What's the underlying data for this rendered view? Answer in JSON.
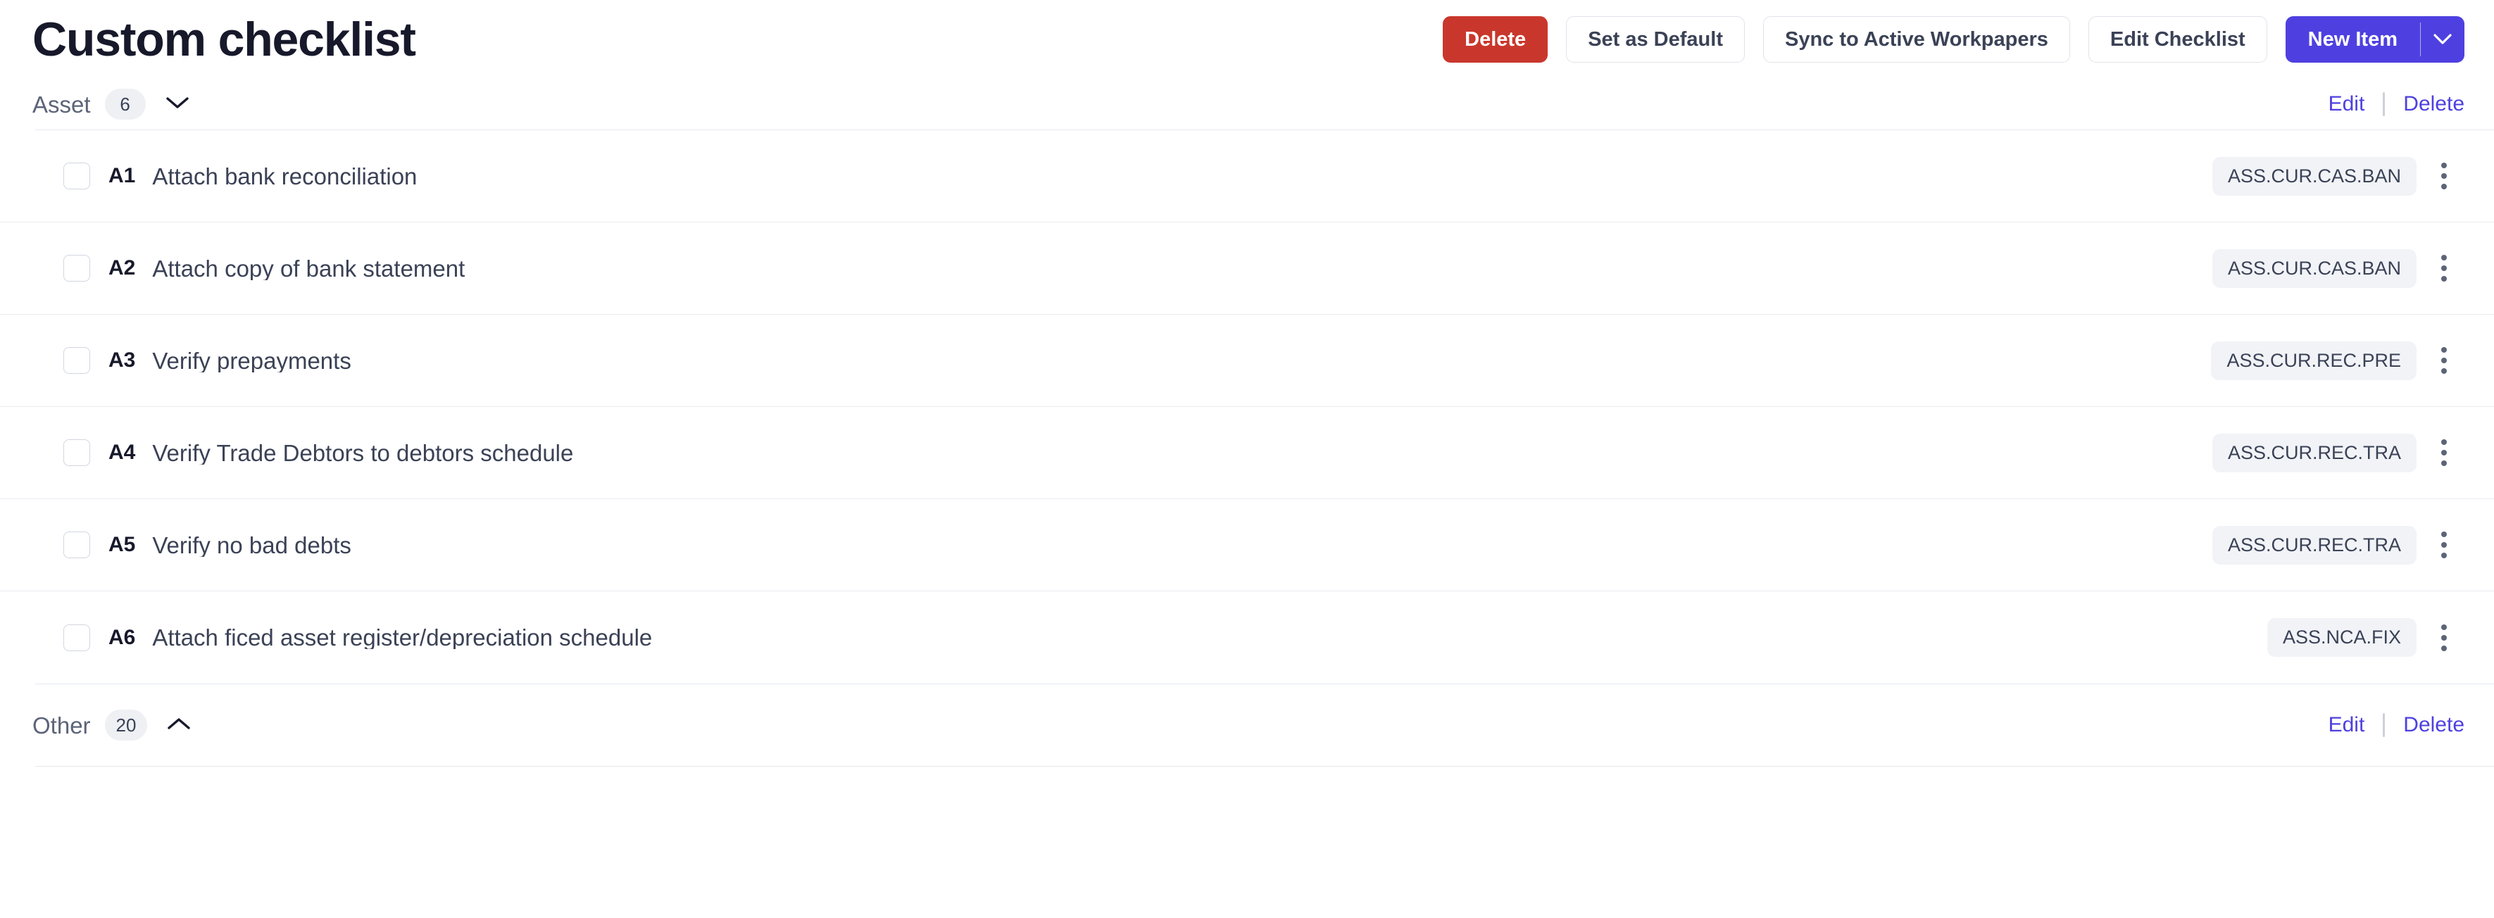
{
  "header": {
    "title": "Custom checklist",
    "actions": {
      "delete_label": "Delete",
      "set_default_label": "Set as Default",
      "sync_label": "Sync to Active Workpapers",
      "edit_checklist_label": "Edit Checklist",
      "new_item_label": "New Item",
      "new_item_caret_icon": "chevron-down-icon"
    },
    "colors": {
      "danger": "#c9372c",
      "primary": "#4e40e0",
      "title_text": "#17192b"
    }
  },
  "sections": [
    {
      "name": "Asset",
      "count": "6",
      "expanded": true,
      "toggle_icon": "chevron-down-icon",
      "edit_label": "Edit",
      "delete_label": "Delete",
      "items": [
        {
          "code": "A1",
          "text": "Attach bank reconciliation",
          "tag": "ASS.CUR.CAS.BAN",
          "checked": false
        },
        {
          "code": "A2",
          "text": "Attach copy of bank statement",
          "tag": "ASS.CUR.CAS.BAN",
          "checked": false
        },
        {
          "code": "A3",
          "text": "Verify prepayments",
          "tag": "ASS.CUR.REC.PRE",
          "checked": false
        },
        {
          "code": "A4",
          "text": "Verify Trade Debtors to debtors schedule",
          "tag": "ASS.CUR.REC.TRA",
          "checked": false
        },
        {
          "code": "A5",
          "text": "Verify no bad debts",
          "tag": "ASS.CUR.REC.TRA",
          "checked": false
        },
        {
          "code": "A6",
          "text": "Attach ficed asset register/depreciation schedule",
          "tag": "ASS.NCA.FIX",
          "checked": false
        }
      ]
    },
    {
      "name": "Other",
      "count": "20",
      "expanded": true,
      "toggle_icon": "chevron-up-icon",
      "edit_label": "Edit",
      "delete_label": "Delete",
      "items": []
    }
  ]
}
